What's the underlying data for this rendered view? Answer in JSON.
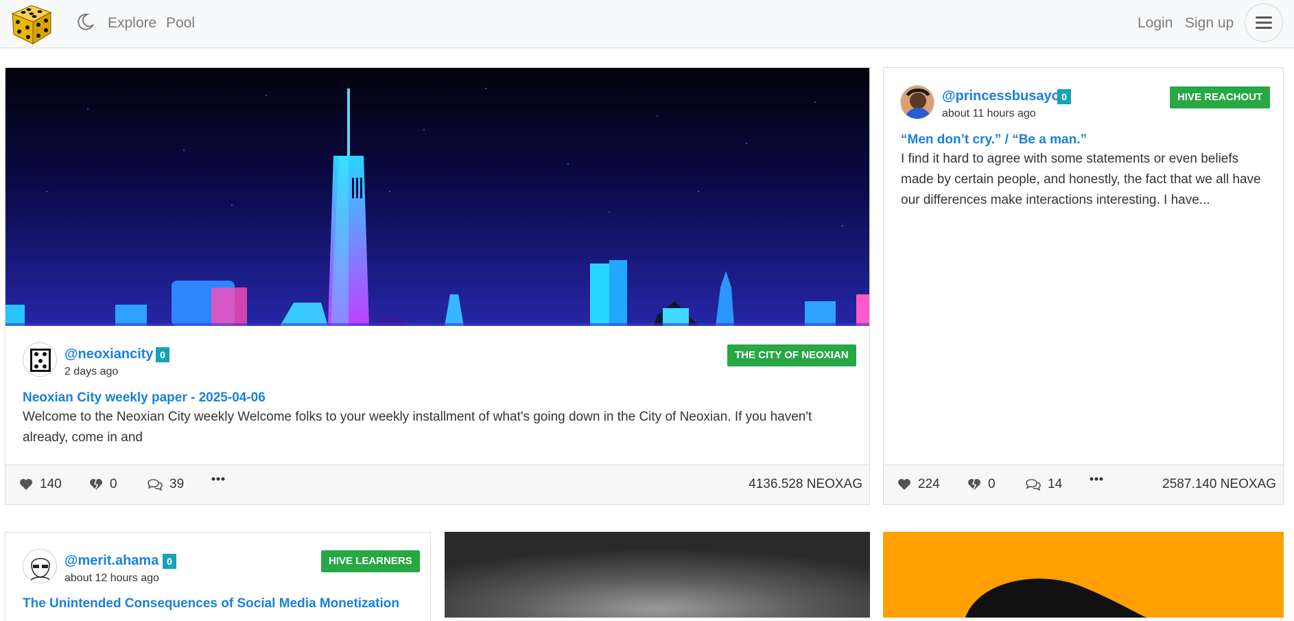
{
  "nav": {
    "explore": "Explore",
    "pool": "Pool",
    "login": "Login",
    "signup": "Sign up"
  },
  "posts": [
    {
      "author": "@neoxiancity",
      "rep": "0",
      "time": "2 days ago",
      "community": "THE CITY OF NEOXIAN",
      "title": "Neoxian City weekly paper - 2025-04-06",
      "excerpt": "Welcome to the Neoxian City weekly Welcome folks to your weekly installment of what's going down in the City of Neoxian. If you haven't already, come in and",
      "likes": "140",
      "downvotes": "0",
      "comments": "39",
      "amount": "4136.528 NEOXAG"
    },
    {
      "author": "@princessbusayo",
      "rep": "0",
      "time": "about 11 hours ago",
      "community": "HIVE REACHOUT",
      "title": "“Men don’t cry.” / “Be a man.”",
      "excerpt": "I find it hard to agree with some statements or even beliefs made by certain people, and honestly, the fact that we all have our differences make interactions interesting. I have...",
      "likes": "224",
      "downvotes": "0",
      "comments": "14",
      "amount": "2587.140 NEOXAG"
    },
    {
      "author": "@merit.ahama",
      "rep": "0",
      "time": "about 12 hours ago",
      "community": "HIVE LEARNERS",
      "title": "The Unintended Consequences of Social Media Monetization"
    }
  ],
  "colors": {
    "accent": "#1a7fe0",
    "community": "#28a745",
    "rep_badge": "#17a2b8",
    "orange_card": "#ffa000"
  },
  "icons": {
    "theme": "moon-icon",
    "menu": "hamburger-icon",
    "like": "heart-icon",
    "downvote": "broken-heart-icon",
    "comments": "comments-icon",
    "more": "ellipsis-icon"
  }
}
